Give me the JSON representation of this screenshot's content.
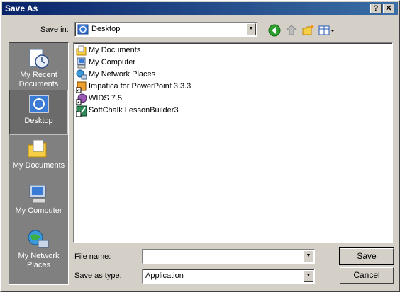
{
  "window": {
    "title": "Save As",
    "help": "?",
    "close": "✕"
  },
  "save_in": {
    "label": "Save in:",
    "value": "Desktop"
  },
  "places": [
    {
      "label": "My Recent Documents",
      "icon": "recent-docs-icon"
    },
    {
      "label": "Desktop",
      "icon": "desktop-icon",
      "selected": true
    },
    {
      "label": "My Documents",
      "icon": "folder-icon"
    },
    {
      "label": "My Computer",
      "icon": "computer-icon"
    },
    {
      "label": "My Network Places",
      "icon": "network-icon"
    }
  ],
  "files": [
    {
      "name": "My Documents",
      "icon": "folder-docs-icon"
    },
    {
      "name": "My Computer",
      "icon": "computer-icon"
    },
    {
      "name": "My Network Places",
      "icon": "network-icon"
    },
    {
      "name": "Impatica for PowerPoint 3.3.3",
      "icon": "shortcut-app-icon"
    },
    {
      "name": "WIDS 7.5",
      "icon": "shortcut-app-icon"
    },
    {
      "name": "SoftChalk LessonBuilder3",
      "icon": "shortcut-check-icon"
    }
  ],
  "filename": {
    "label": "File name:",
    "value": ""
  },
  "filetype": {
    "label": "Save as type:",
    "value": "Application"
  },
  "buttons": {
    "save": "Save",
    "cancel": "Cancel"
  }
}
